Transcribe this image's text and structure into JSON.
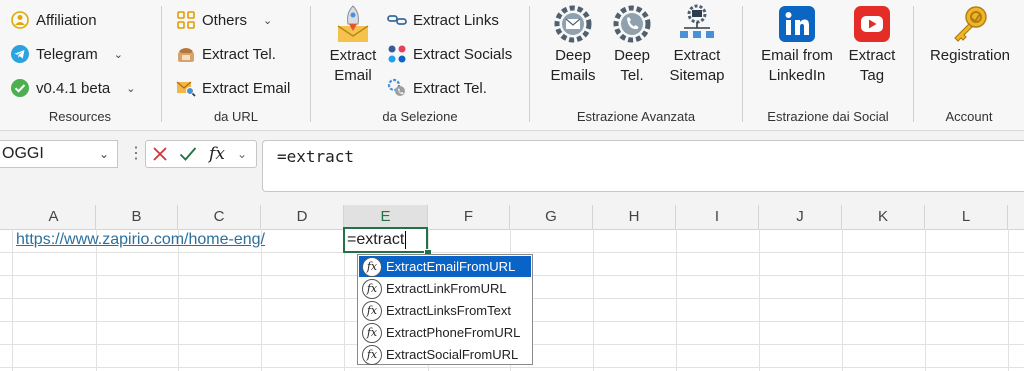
{
  "ribbon": {
    "resources": {
      "label": "Resources",
      "items": [
        {
          "label": "Affiliation",
          "icon": "affiliation-icon"
        },
        {
          "label": "Telegram",
          "icon": "telegram-icon"
        },
        {
          "label": "v0.4.1 beta",
          "icon": "check-circle-icon"
        }
      ]
    },
    "da_url": {
      "label": "da URL",
      "items": [
        {
          "label": "Others",
          "icon": "grid-icon"
        },
        {
          "label": "Extract Tel.",
          "icon": "phone-icon"
        },
        {
          "label": "Extract Email",
          "icon": "email-search-icon"
        }
      ]
    },
    "da_selezione": {
      "label": "da Selezione",
      "big": {
        "line1": "Extract",
        "line2": "Email",
        "icon": "rocket-envelope-icon"
      },
      "items": [
        {
          "label": "Extract Links",
          "icon": "links-icon"
        },
        {
          "label": "Extract Socials",
          "icon": "socials-icon"
        },
        {
          "label": "Extract Tel.",
          "icon": "phone-gear-icon"
        }
      ]
    },
    "estrazione_avanzata": {
      "label": "Estrazione Avanzata",
      "buttons": [
        {
          "line1": "Deep",
          "line2": "Emails",
          "icon": "deep-emails-gear-icon"
        },
        {
          "line1": "Deep",
          "line2": "Tel.",
          "icon": "deep-tel-gear-icon"
        },
        {
          "line1": "Extract",
          "line2": "Sitemap",
          "icon": "sitemap-icon"
        }
      ]
    },
    "estrazione_social": {
      "label": "Estrazione dai Social",
      "buttons": [
        {
          "line1": "Email from",
          "line2": "LinkedIn",
          "icon": "linkedin-icon"
        },
        {
          "line1": "Extract",
          "line2": "Tag",
          "icon": "youtube-icon"
        }
      ]
    },
    "account": {
      "label": "Account",
      "buttons": [
        {
          "line1": "Registration",
          "line2": "",
          "icon": "key-icon"
        }
      ]
    }
  },
  "formula_bar": {
    "name_box": "OGGI",
    "formula": "=extract"
  },
  "columns": [
    "A",
    "B",
    "C",
    "D",
    "E",
    "F",
    "G",
    "H",
    "I",
    "J",
    "K",
    "L"
  ],
  "cells": {
    "a1": "https://www.zapirio.com/home-eng/",
    "e1": "=extract"
  },
  "autocomplete": {
    "items": [
      "ExtractEmailFromURL",
      "ExtractLinkFromURL",
      "ExtractLinksFromText",
      "ExtractPhoneFromURL",
      "ExtractSocialFromURL"
    ],
    "selected_index": 0
  },
  "colors": {
    "accent": "#217346",
    "selection": "#0a64c8",
    "link": "#2c6f9c"
  }
}
